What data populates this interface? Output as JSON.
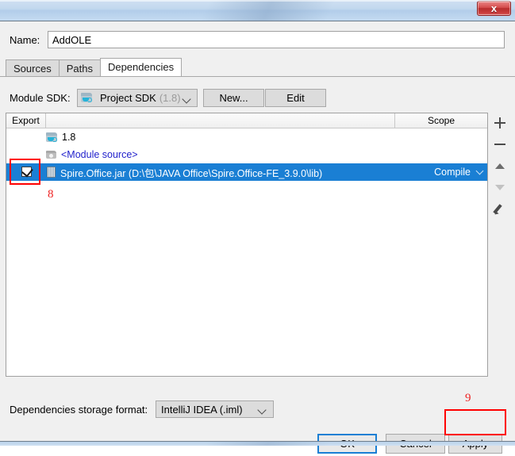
{
  "window": {
    "title": "",
    "close_label": "x"
  },
  "name_field": {
    "label": "Name:",
    "value": "AddOLE",
    "placeholder": ""
  },
  "tabs": [
    {
      "label": "Sources",
      "active": false
    },
    {
      "label": "Paths",
      "active": false
    },
    {
      "label": "Dependencies",
      "active": true
    }
  ],
  "sdk_row": {
    "label": "Module SDK:",
    "selected": "Project SDK",
    "version": "(1.8)",
    "new_button": "New...",
    "edit_button": "Edit"
  },
  "table": {
    "headers": {
      "export": "Export",
      "middle": "",
      "scope": "Scope"
    },
    "rows": [
      {
        "icon": "sdk-icon",
        "label": "1.8",
        "scope": "",
        "checkbox": "none",
        "selected": false,
        "blue_text": false
      },
      {
        "icon": "module-source-icon",
        "label": "<Module source>",
        "scope": "",
        "checkbox": "none",
        "selected": false,
        "blue_text": true
      },
      {
        "icon": "jar-icon",
        "label": "Spire.Office.jar (D:\\包\\JAVA Office\\Spire.Office-FE_3.9.0\\lib)",
        "scope": "Compile",
        "checkbox": "checked",
        "selected": true,
        "blue_text": false
      }
    ]
  },
  "side_toolbar": [
    {
      "name": "add-button",
      "glyph": "plus-icon",
      "enabled": true
    },
    {
      "name": "remove-button",
      "glyph": "minus-icon",
      "enabled": true
    },
    {
      "name": "move-up-button",
      "glyph": "arrow-up-icon",
      "enabled": true
    },
    {
      "name": "move-down-button",
      "glyph": "arrow-down-icon",
      "enabled": false
    },
    {
      "name": "edit-button",
      "glyph": "pencil-icon",
      "enabled": true
    }
  ],
  "storage_row": {
    "label": "Dependencies storage format:",
    "selected": "IntelliJ IDEA (.iml)"
  },
  "dialog_buttons": {
    "ok": "OK",
    "cancel": "Cancel",
    "apply": "Apply"
  },
  "annotations": [
    {
      "id": "8",
      "text": "8",
      "target": "export-checkbox"
    },
    {
      "id": "9",
      "text": "9",
      "target": "apply-button"
    }
  ],
  "colors": {
    "selection_blue": "#1a7fd4",
    "annotation_red": "#ff0000",
    "link_blue": "#2222cc",
    "titlebar_blue": "#b2cdea",
    "close_red": "#b72d2d"
  }
}
